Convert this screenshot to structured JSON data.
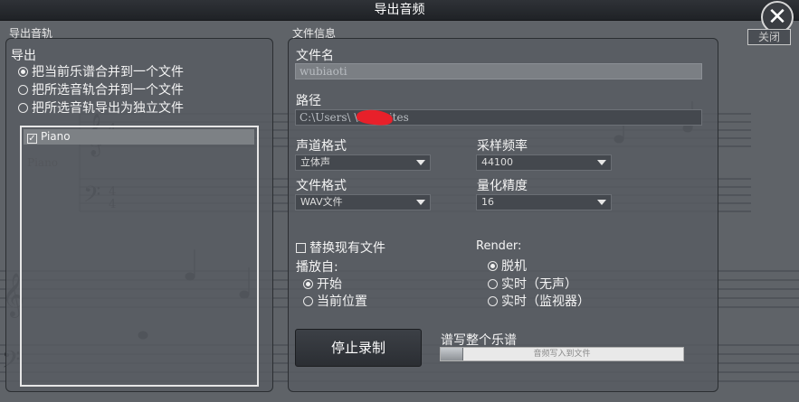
{
  "window": {
    "title": "导出音频",
    "close_label": "关闭"
  },
  "export_tracks": {
    "section_title": "导出音轨",
    "export_label": "导出",
    "options": [
      {
        "label": "把当前乐谱合并到一个文件",
        "selected": true
      },
      {
        "label": "把所选音轨合并到一个文件",
        "selected": false
      },
      {
        "label": "把所选音轨导出为独立文件",
        "selected": false
      }
    ],
    "tracks": [
      {
        "name": "Piano",
        "checked": true
      }
    ]
  },
  "file_info": {
    "section_title": "文件信息",
    "filename_label": "文件名",
    "filename_value": "wubiaoti",
    "path_label": "路径",
    "path_value": "C:\\Users\\      \\Favorites",
    "channel_label": "声道格式",
    "channel_value": "立体声",
    "sample_rate_label": "采样频率",
    "sample_rate_value": "44100",
    "file_format_label": "文件格式",
    "file_format_value": "WAV文件",
    "bit_depth_label": "量化精度",
    "bit_depth_value": "16",
    "replace_label": "替换现有文件",
    "replace_checked": false,
    "playback_label": "播放自:",
    "playback_options": [
      {
        "label": "开始",
        "selected": true
      },
      {
        "label": "当前位置",
        "selected": false
      }
    ],
    "render_label": "Render:",
    "render_options": [
      {
        "label": "脱机",
        "selected": true
      },
      {
        "label": "实时（无声）",
        "selected": false
      },
      {
        "label": "实时（监视器）",
        "selected": false
      }
    ],
    "stop_button": "停止录制",
    "progress_label": "谱写整个乐谱",
    "progress_text": "音频写入到文件",
    "progress_fraction": 0.09
  },
  "score_background": {
    "instrument": "Piano",
    "time_signature": "4/4"
  },
  "colors": {
    "redaction": "#e8202a"
  }
}
